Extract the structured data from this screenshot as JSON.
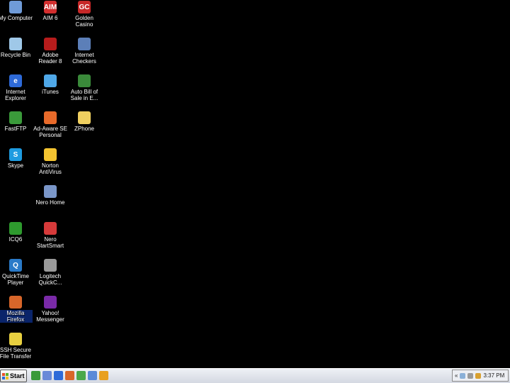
{
  "desktop": {
    "icons": [
      {
        "label": "My Computer",
        "icon": "my-computer-icon",
        "color": "#6f9bd8"
      },
      {
        "label": "AIM 6",
        "icon": "aim-icon",
        "color": "#d32f2f",
        "text": "AIM"
      },
      {
        "label": "Golden\nCasino",
        "icon": "golden-casino-icon",
        "color": "#c62828",
        "text": "GC"
      },
      {
        "label": "Recycle Bin",
        "icon": "recycle-bin-icon",
        "color": "#9fc8e8"
      },
      {
        "label": "Adobe\nReader 8",
        "icon": "adobe-reader-icon",
        "color": "#b71c1c"
      },
      {
        "label": "Internet\nCheckers",
        "icon": "internet-checkers-icon",
        "color": "#5c7fb8"
      },
      {
        "label": "Internet\nExplorer",
        "icon": "internet-explorer-icon",
        "color": "#2e6ad8",
        "text": "e"
      },
      {
        "label": "iTunes",
        "icon": "itunes-icon",
        "color": "#4fa8e8"
      },
      {
        "label": "Auto Bill of\nSale in E...",
        "icon": "auto-bill-of-sale-icon",
        "color": "#3a8a3a"
      },
      {
        "label": "FastFTP",
        "icon": "fastftp-icon",
        "color": "#3a9a3a"
      },
      {
        "label": "Ad-Aware SE\nPersonal",
        "icon": "ad-aware-icon",
        "color": "#e86a2a"
      },
      {
        "label": "ZPhone",
        "icon": "folder-icon",
        "color": "#f0d060"
      },
      {
        "label": "Skype",
        "icon": "skype-icon",
        "color": "#1e9be0",
        "text": "S"
      },
      {
        "label": "Norton\nAntiVirus",
        "icon": "norton-antivirus-icon",
        "color": "#f4c430"
      },
      {
        "label": "Nero Home",
        "icon": "nero-home-icon",
        "color": "#7a96c8"
      },
      {
        "label": "ICQ6",
        "icon": "icq-icon",
        "color": "#2e9a2e"
      },
      {
        "label": "Nero\nStartSmart",
        "icon": "nero-startsmart-icon",
        "color": "#d63a3a"
      },
      {
        "label": "QuickTime\nPlayer",
        "icon": "quicktime-icon",
        "color": "#2a7ac8",
        "text": "Q"
      },
      {
        "label": "Logitech\nQuickC...",
        "icon": "logitech-quickcam-icon",
        "color": "#9a9a9a"
      },
      {
        "label": "Mozilla\nFirefox",
        "icon": "firefox-icon",
        "color": "#d8662a"
      },
      {
        "label": "Yahoo!\nMessenger",
        "icon": "yahoo-messenger-icon",
        "color": "#7a2aa8"
      },
      {
        "label": "SSH Secure\nFile Transfer",
        "icon": "ssh-file-transfer-icon",
        "color": "#e8d040"
      }
    ]
  },
  "taskbar": {
    "start_label": "Start",
    "quick_launch": [
      {
        "icon": "quick-launch-1-icon",
        "color": "#3a9a3a"
      },
      {
        "icon": "show-desktop-icon",
        "color": "#6a8ad8"
      },
      {
        "icon": "internet-explorer-quick-icon",
        "color": "#2e6ad8"
      },
      {
        "icon": "firefox-quick-icon",
        "color": "#d8662a"
      },
      {
        "icon": "outlook-express-icon",
        "color": "#4aa84a"
      },
      {
        "icon": "ie-quick-2-icon",
        "color": "#5a8ad8"
      },
      {
        "icon": "aim-quick-icon",
        "color": "#e8a020"
      }
    ],
    "tray": {
      "chevron": "«",
      "clock": "3:37 PM"
    }
  }
}
